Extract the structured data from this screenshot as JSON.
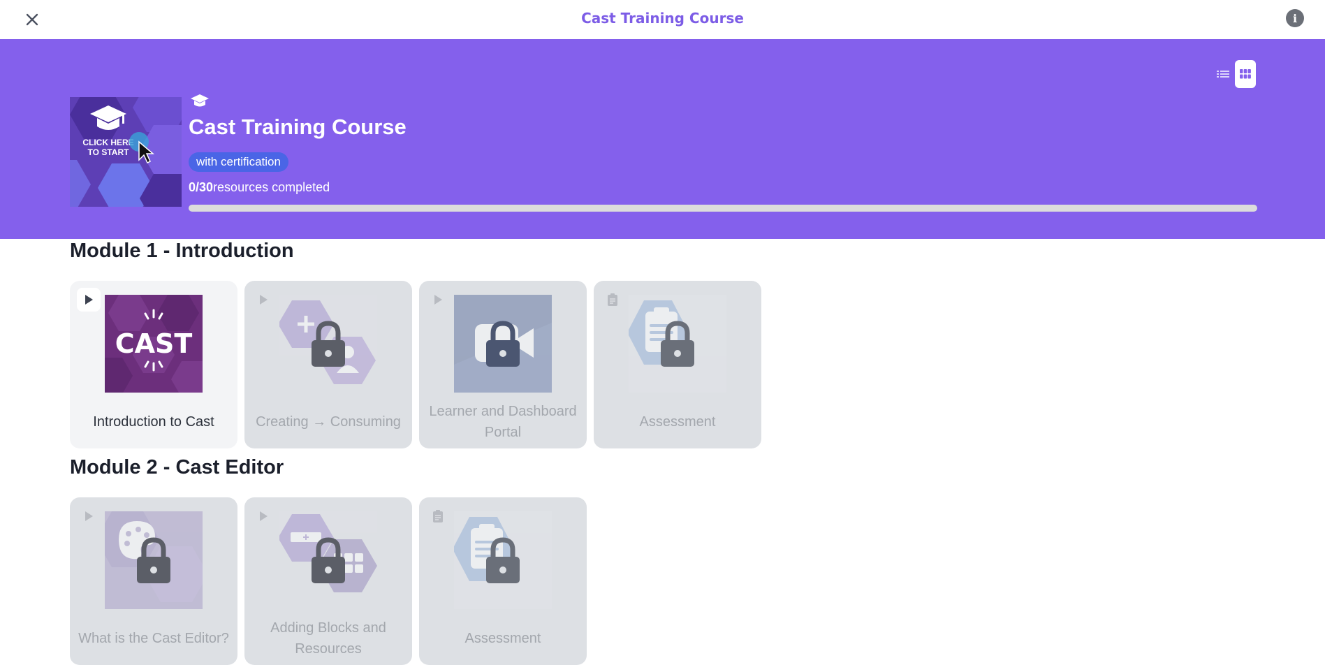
{
  "app": {
    "window_title": "Cast Training Course"
  },
  "hero": {
    "thumbnail_text_line1": "CLICK HERE",
    "thumbnail_text_line2": "TO START",
    "title": "Cast Training Course",
    "badge": "with certification",
    "progress_count": "0/30",
    "progress_label": "resources completed",
    "progress_fraction": 0.0
  },
  "view_toggle": {
    "selected": "grid"
  },
  "modules": [
    {
      "title": "Module 1 - Introduction",
      "cards": [
        {
          "label": "Introduction to Cast",
          "type_icon": "play-icon",
          "art": "cast-logo",
          "locked": false
        },
        {
          "label": "Creating → Consuming",
          "type_icon": "play-icon",
          "art": "plus-person-hexes",
          "locked": true
        },
        {
          "label": "Learner and Dashboard Portal",
          "type_icon": "play-icon",
          "art": "video-camera",
          "locked": true
        },
        {
          "label": "Assessment",
          "type_icon": "clipboard-icon",
          "art": "clipboard-hex",
          "locked": true
        }
      ]
    },
    {
      "title": "Module 2 - Cast Editor",
      "cards": [
        {
          "label": "What is the Cast Editor?",
          "type_icon": "play-icon",
          "art": "palette-hexes",
          "locked": true
        },
        {
          "label": "Adding Blocks and Resources",
          "type_icon": "play-icon",
          "art": "blocks-hexes",
          "locked": true
        },
        {
          "label": "Assessment",
          "type_icon": "clipboard-icon",
          "art": "clipboard-hex",
          "locked": true
        }
      ]
    }
  ],
  "colors": {
    "accent": "#8460ec",
    "title_purple": "#7c5ce6",
    "badge_blue": "#4a65e6",
    "locked_card": "#dde0e4"
  }
}
